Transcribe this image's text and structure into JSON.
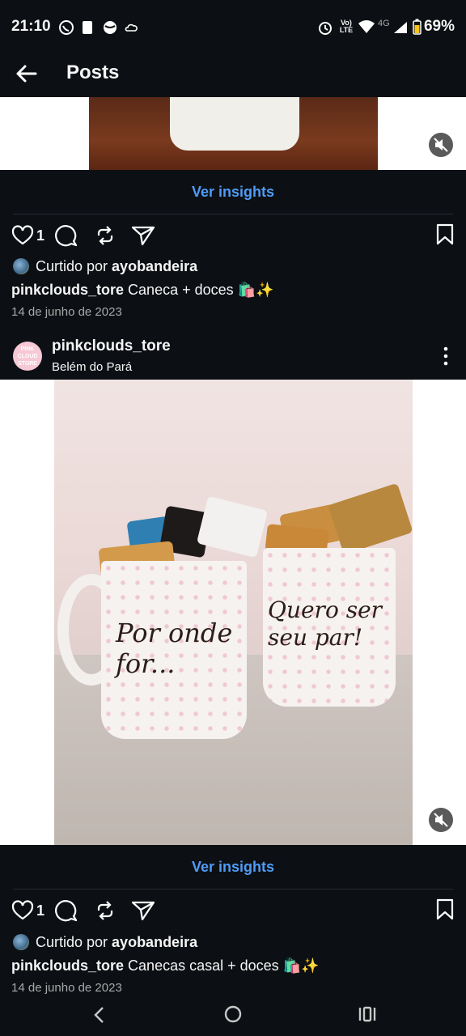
{
  "status_bar": {
    "time": "21:10",
    "network": "4G",
    "volte": "Vo) LTE",
    "battery": "69%"
  },
  "header": {
    "title": "Posts"
  },
  "posts": [
    {
      "insights_label": "Ver insights",
      "like_count": "1",
      "liked_by_prefix": "Curtido por ",
      "liked_by_user": "ayobandeira",
      "username": "pinkclouds_tore",
      "caption": "Caneca + doces 🛍️✨",
      "date": "14 de junho de 2023"
    },
    {
      "username": "pinkclouds_tore",
      "location": "Belém do Pará",
      "avatar_text": "PINK CLOUD STORE",
      "image_text_left": "Por onde for...",
      "image_text_right": "Quero ser seu par!",
      "insights_label": "Ver insights",
      "like_count": "1",
      "liked_by_prefix": "Curtido por ",
      "liked_by_user": "ayobandeira",
      "caption": "Canecas casal + doces 🛍️✨",
      "date": "14 de junho de 2023"
    }
  ],
  "colors": {
    "background": "#0c1014",
    "link": "#4f9cf6",
    "muted": "#a8a8a8"
  }
}
